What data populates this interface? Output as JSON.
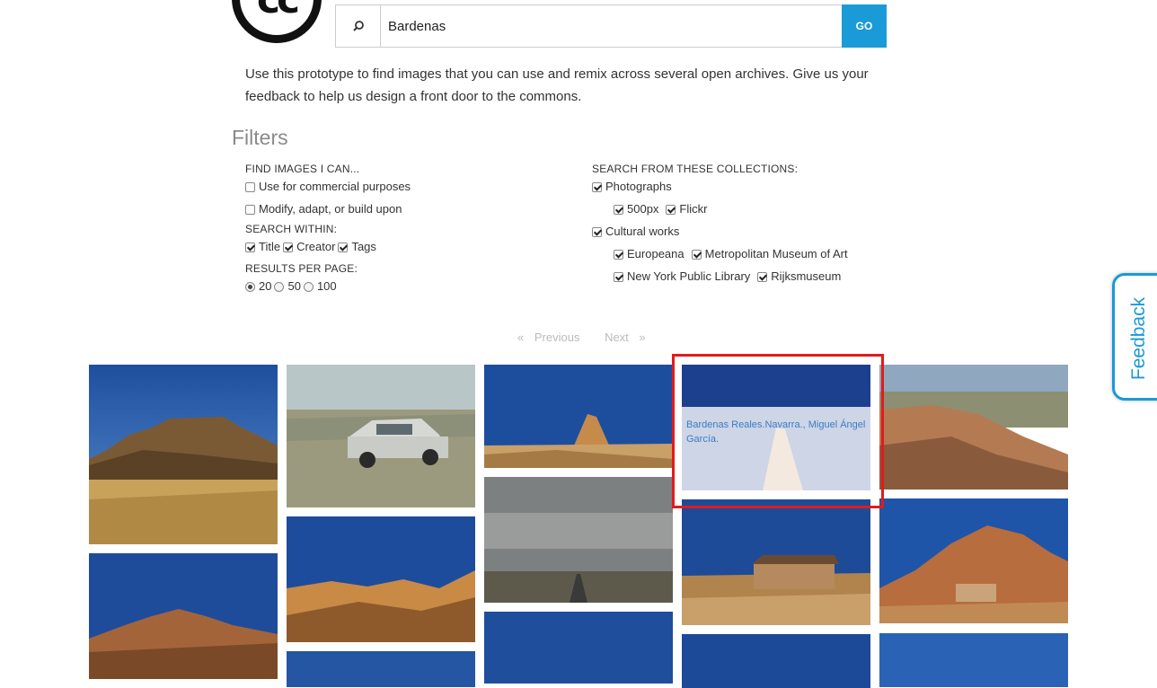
{
  "logo": {
    "text": "cc"
  },
  "search": {
    "value": "Bardenas",
    "go_label": "GO"
  },
  "intro": "Use this prototype to find images that you can use and remix across several open archives. Give us your feedback to help us design a front door to the commons.",
  "filters": {
    "heading": "Filters",
    "find_images_label": "FIND IMAGES I CAN...",
    "find_options": [
      {
        "label": "Use for commercial purposes",
        "checked": false
      },
      {
        "label": "Modify, adapt, or build upon",
        "checked": false
      }
    ],
    "search_within_label": "SEARCH WITHIN:",
    "search_within": [
      {
        "label": "Title",
        "checked": true
      },
      {
        "label": "Creator",
        "checked": true
      },
      {
        "label": "Tags",
        "checked": true
      }
    ],
    "results_per_page_label": "RESULTS PER PAGE:",
    "results_per_page": [
      {
        "label": "20",
        "checked": true
      },
      {
        "label": "50",
        "checked": false
      },
      {
        "label": "100",
        "checked": false
      }
    ],
    "collections_label": "SEARCH FROM THESE COLLECTIONS:",
    "photographs": {
      "label": "Photographs",
      "checked": true
    },
    "photo_sources": [
      {
        "label": "500px",
        "checked": true
      },
      {
        "label": "Flickr",
        "checked": true
      }
    ],
    "cultural": {
      "label": "Cultural works",
      "checked": true
    },
    "cultural_sources_row1": [
      {
        "label": "Europeana",
        "checked": true
      },
      {
        "label": "Metropolitan Museum of Art",
        "checked": true
      }
    ],
    "cultural_sources_row2": [
      {
        "label": "New York Public Library",
        "checked": true
      },
      {
        "label": "Rijksmuseum",
        "checked": true
      }
    ]
  },
  "pager": {
    "prev_arrow": "«",
    "prev": "Previous",
    "next": "Next",
    "next_arrow": "»"
  },
  "feedback": "Feedback",
  "hover_card": {
    "title": "Bardenas Reales.Navarra., Miguel Ángel García.",
    "icons": [
      "attribution-icon",
      "list-icon",
      "star-icon"
    ]
  },
  "colors": {
    "accent": "#1a9ad6",
    "highlight": "#e21b1b",
    "list_badge": "#19a83a"
  }
}
